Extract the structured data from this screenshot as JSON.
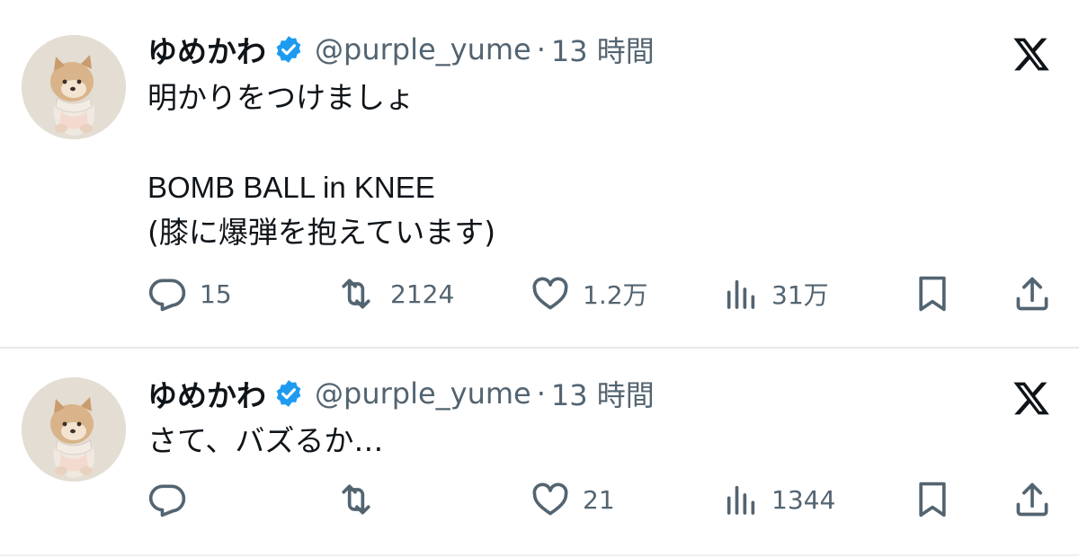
{
  "colors": {
    "text_primary": "#0f1419",
    "text_secondary": "#536471",
    "verified_blue": "#1d9bf0",
    "divider": "#e6e9eb"
  },
  "tweets": [
    {
      "display_name": "ゆめかわ",
      "handle": "@purple_yume",
      "separator": "·",
      "time": "13 時間",
      "avatar_icon": "shiba-dog-avatar",
      "logo_icon": "x-logo-icon",
      "text_lines": [
        "明かりをつけましょ",
        "BOMB BALL in KNEE",
        "(膝に爆弾を抱えています)"
      ],
      "stats": {
        "replies": "15",
        "reposts": "2124",
        "likes": "1.2万",
        "views": "31万"
      }
    },
    {
      "display_name": "ゆめかわ",
      "handle": "@purple_yume",
      "separator": "·",
      "time": "13 時間",
      "avatar_icon": "shiba-dog-avatar",
      "logo_icon": "x-logo-icon",
      "text_lines": [
        "さて、バズるか…"
      ],
      "stats": {
        "replies": "",
        "reposts": "",
        "likes": "21",
        "views": "1344"
      }
    }
  ]
}
